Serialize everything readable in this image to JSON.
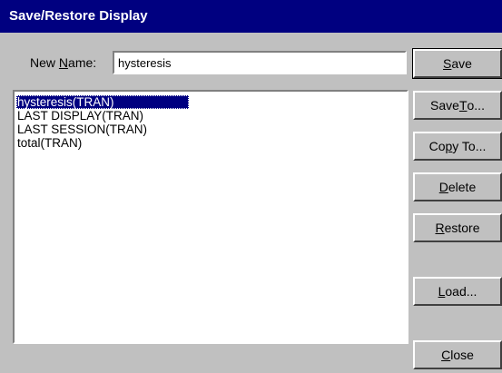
{
  "window": {
    "title": "Save/Restore Display"
  },
  "name_field": {
    "label_before": "New ",
    "label_mnemonic": "N",
    "label_after": "ame:",
    "value": "hysteresis"
  },
  "list": {
    "items": [
      {
        "label": "hysteresis(TRAN)",
        "selected": true
      },
      {
        "label": "LAST DISPLAY(TRAN)",
        "selected": false
      },
      {
        "label": "LAST SESSION(TRAN)",
        "selected": false
      },
      {
        "label": "total(TRAN)",
        "selected": false
      }
    ]
  },
  "buttons": {
    "save": {
      "pre": "",
      "key": "S",
      "post": "ave"
    },
    "save_to": {
      "pre": "Save ",
      "key": "T",
      "post": "o..."
    },
    "copy_to": {
      "pre": "Co",
      "key": "p",
      "post": "y To..."
    },
    "delete": {
      "pre": "",
      "key": "D",
      "post": "elete"
    },
    "restore": {
      "pre": "",
      "key": "R",
      "post": "estore"
    },
    "load": {
      "pre": "",
      "key": "L",
      "post": "oad..."
    },
    "close": {
      "pre": "",
      "key": "C",
      "post": "lose"
    }
  }
}
